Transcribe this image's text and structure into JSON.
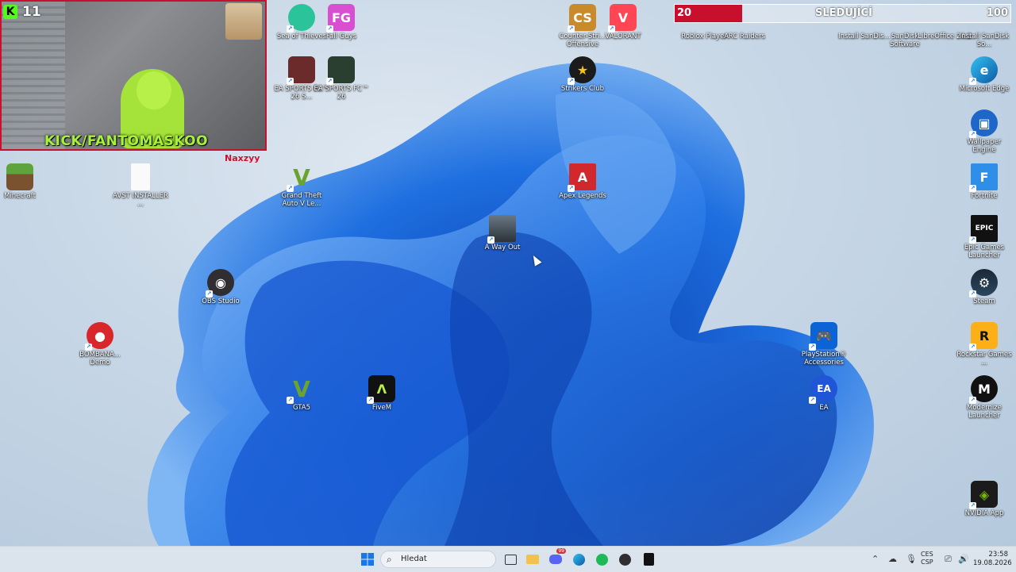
{
  "webcam": {
    "kick_badge": "K",
    "kick_count": "11",
    "channel": "KICK/FANTOMASKOO",
    "nickname": "Naxzyy"
  },
  "follow_goal": {
    "current": "20",
    "label": "SLEDUJÍCÍ",
    "goal": "100",
    "progress_fraction": 0.2
  },
  "desktop_icons": {
    "sea_of_thieves": "Sea of Thieves",
    "fall_guys": "Fall Guys",
    "ea_fc_1": "EA SPORTS FC™ 26 S...",
    "ea_fc_2": "EA SPORTS FC™ 26",
    "counter_strike": "Counter-Stri... Offensive",
    "valorant": "VALORANT",
    "roblox": "Roblox Player",
    "arc_raiders": "ARC Raiders",
    "install_sandisk_1": "Install SanDis...",
    "sandisk_software": "SanDisk Software",
    "libreoffice": "LibreOffice 24.8",
    "install_sandisk_2": "Install SanDisk So...",
    "strikers_club": "Strikers Club",
    "microsoft_edge": "Microsoft Edge",
    "wallpaper_engine": "Wallpaper Engine",
    "minecraft": "Minecraft",
    "avst_installer": "AVST INSTALLER ...",
    "gta_v_legacy": "Grand Theft Auto V Le...",
    "apex": "Apex Legends",
    "fortnite": "Fortnite",
    "a_way_out": "A Way Out",
    "epic_games": "Epic Games Launcher",
    "obs": "OBS Studio",
    "steam": "Steam",
    "bombana": "BOMBANA... Demo",
    "playstation": "PlayStation® Accessories",
    "rockstar": "Rockstar Games ...",
    "gta5": "GTA5",
    "fivem": "FiveM",
    "ea": "EA",
    "modernize": "Modernize Launcher",
    "nvidia": "NVIDIA App"
  },
  "taskbar": {
    "search_placeholder": "Hledat",
    "discord_badge": "99",
    "lang_top": "CES",
    "lang_bottom": "CSP",
    "time": "23:58",
    "date": "19.08.2026"
  },
  "colors": {
    "accent_red": "#c8102e",
    "kick_green": "#53fc18",
    "bloom_blue": "#1e6fe0"
  }
}
